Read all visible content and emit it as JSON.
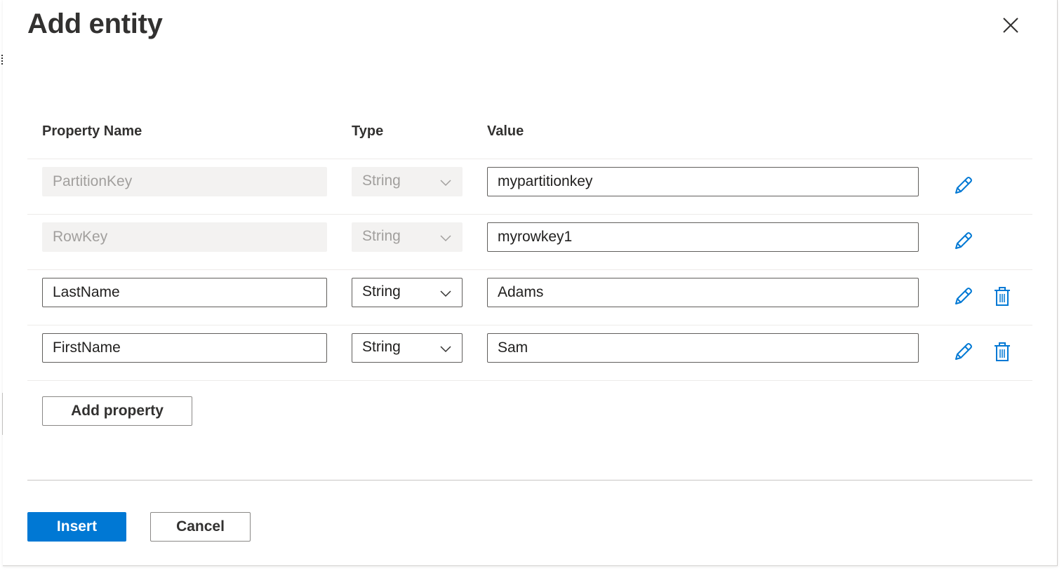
{
  "dialog": {
    "title": "Add entity",
    "close_icon": "close-icon"
  },
  "table": {
    "headers": {
      "property_name": "Property Name",
      "type": "Type",
      "value": "Value"
    },
    "rows": [
      {
        "name": "PartitionKey",
        "type": "String",
        "value": "mypartitionkey",
        "editable": false,
        "deletable": false
      },
      {
        "name": "RowKey",
        "type": "String",
        "value": "myrowkey1",
        "editable": false,
        "deletable": false
      },
      {
        "name": "LastName",
        "type": "String",
        "value": "Adams",
        "editable": true,
        "deletable": true
      },
      {
        "name": "FirstName",
        "type": "String",
        "value": "Sam",
        "editable": true,
        "deletable": true
      }
    ]
  },
  "actions": {
    "add_property": "Add property",
    "insert": "Insert",
    "cancel": "Cancel"
  },
  "icons": {
    "edit": "pencil-icon",
    "delete": "trash-icon",
    "dropdown": "chevron-down-icon"
  },
  "colors": {
    "accent": "#0078d4",
    "icon_blue": "#0078d4"
  }
}
